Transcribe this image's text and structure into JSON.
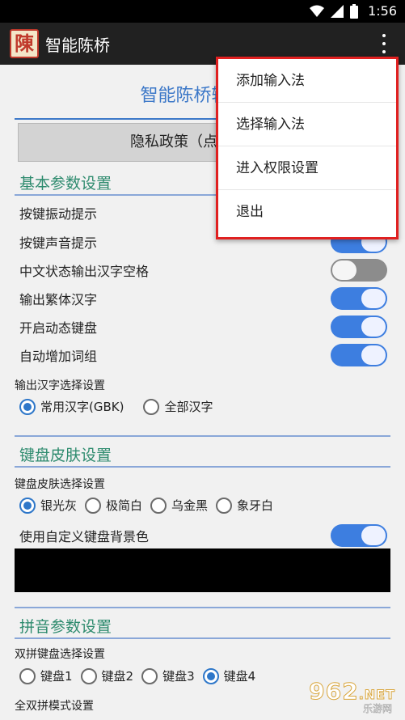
{
  "status_bar": {
    "time": "1:56"
  },
  "app_bar": {
    "logo_text": "陳",
    "title": "智能陈桥"
  },
  "main": {
    "page_title": "智能陈桥输入法",
    "privacy_button": "隐私政策（点击查看）",
    "basic_section": {
      "title": "基本参数设置",
      "rows": [
        {
          "label": "按键振动提示",
          "on": true
        },
        {
          "label": "按键声音提示",
          "on": true
        },
        {
          "label": "中文状态输出汉字空格",
          "on": false
        },
        {
          "label": "输出繁体汉字",
          "on": true
        },
        {
          "label": "开启动态键盘",
          "on": true
        },
        {
          "label": "自动增加词组",
          "on": true
        }
      ],
      "charset_label": "输出汉字选择设置",
      "charset_options": [
        "常用汉字(GBK)",
        "全部汉字"
      ],
      "charset_selected": 0
    },
    "skin_section": {
      "title": "键盘皮肤设置",
      "skin_label": "键盘皮肤选择设置",
      "skin_options": [
        "银光灰",
        "极简白",
        "乌金黑",
        "象牙白"
      ],
      "skin_selected": 0,
      "custom_bg_label": "使用自定义键盘背景色",
      "custom_bg_on": true,
      "custom_bg_color": "#000000"
    },
    "pinyin_section": {
      "title": "拼音参数设置",
      "shuangpin_label": "双拼键盘选择设置",
      "keyboard_options": [
        "键盘1",
        "键盘2",
        "键盘3",
        "键盘4"
      ],
      "keyboard_selected": 3,
      "mode_label": "全双拼模式设置"
    }
  },
  "overflow_menu": {
    "items": [
      "添加输入法",
      "选择输入法",
      "进入权限设置",
      "退出"
    ]
  },
  "watermark": {
    "number": "962",
    "suffix": ".NET",
    "sub": "乐游网"
  },
  "colors": {
    "accent": "#3c78c8",
    "section": "#2e8b6e",
    "toggle_on": "#3d7ee0",
    "highlight": "#e02020"
  }
}
